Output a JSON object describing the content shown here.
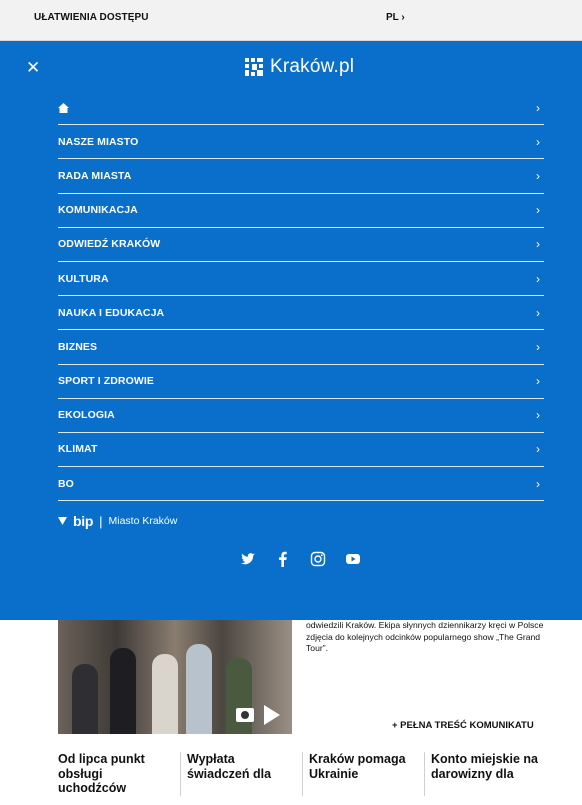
{
  "topbar": {
    "accessibility": "UŁATWIENIA DOSTĘPU",
    "language": "PL ›"
  },
  "menu": {
    "close_icon": "✕",
    "logo_text": "Kraków.pl",
    "items": [
      {
        "label": "",
        "icon": "home-icon"
      },
      {
        "label": "NASZE MIASTO"
      },
      {
        "label": "RADA MIASTA"
      },
      {
        "label": "KOMUNIKACJA"
      },
      {
        "label": "ODWIEDŹ KRAKÓW"
      },
      {
        "label": "KULTURA"
      },
      {
        "label": "NAUKA I EDUKACJA"
      },
      {
        "label": "BIZNES"
      },
      {
        "label": "SPORT I ZDROWIE"
      },
      {
        "label": "EKOLOGIA"
      },
      {
        "label": "KLIMAT"
      },
      {
        "label": "BO"
      }
    ],
    "chevron": "›",
    "bip": {
      "word": "bip",
      "separator": "|",
      "city": "Miasto Kraków"
    },
    "social": [
      "twitter-icon",
      "facebook-icon",
      "instagram-icon",
      "youtube-icon"
    ]
  },
  "content": {
    "description": "odwiedzili Kraków. Ekipa słynnych dziennikarzy kręci w Polsce zdjęcia do kolejnych odcinków popularnego show „The Grand Tour”.",
    "more_link": "+ PEŁNA TREŚĆ KOMUNIKATU",
    "cards": [
      "Od lipca punkt obsługi uchodźców",
      "Wypłata świadczeń dla",
      "Kraków pomaga Ukrainie",
      "Konto miejskie na darowizny dla"
    ]
  },
  "colors": {
    "menu_bg": "#0a6ecb",
    "topbar_bg": "#f2f2f2"
  }
}
